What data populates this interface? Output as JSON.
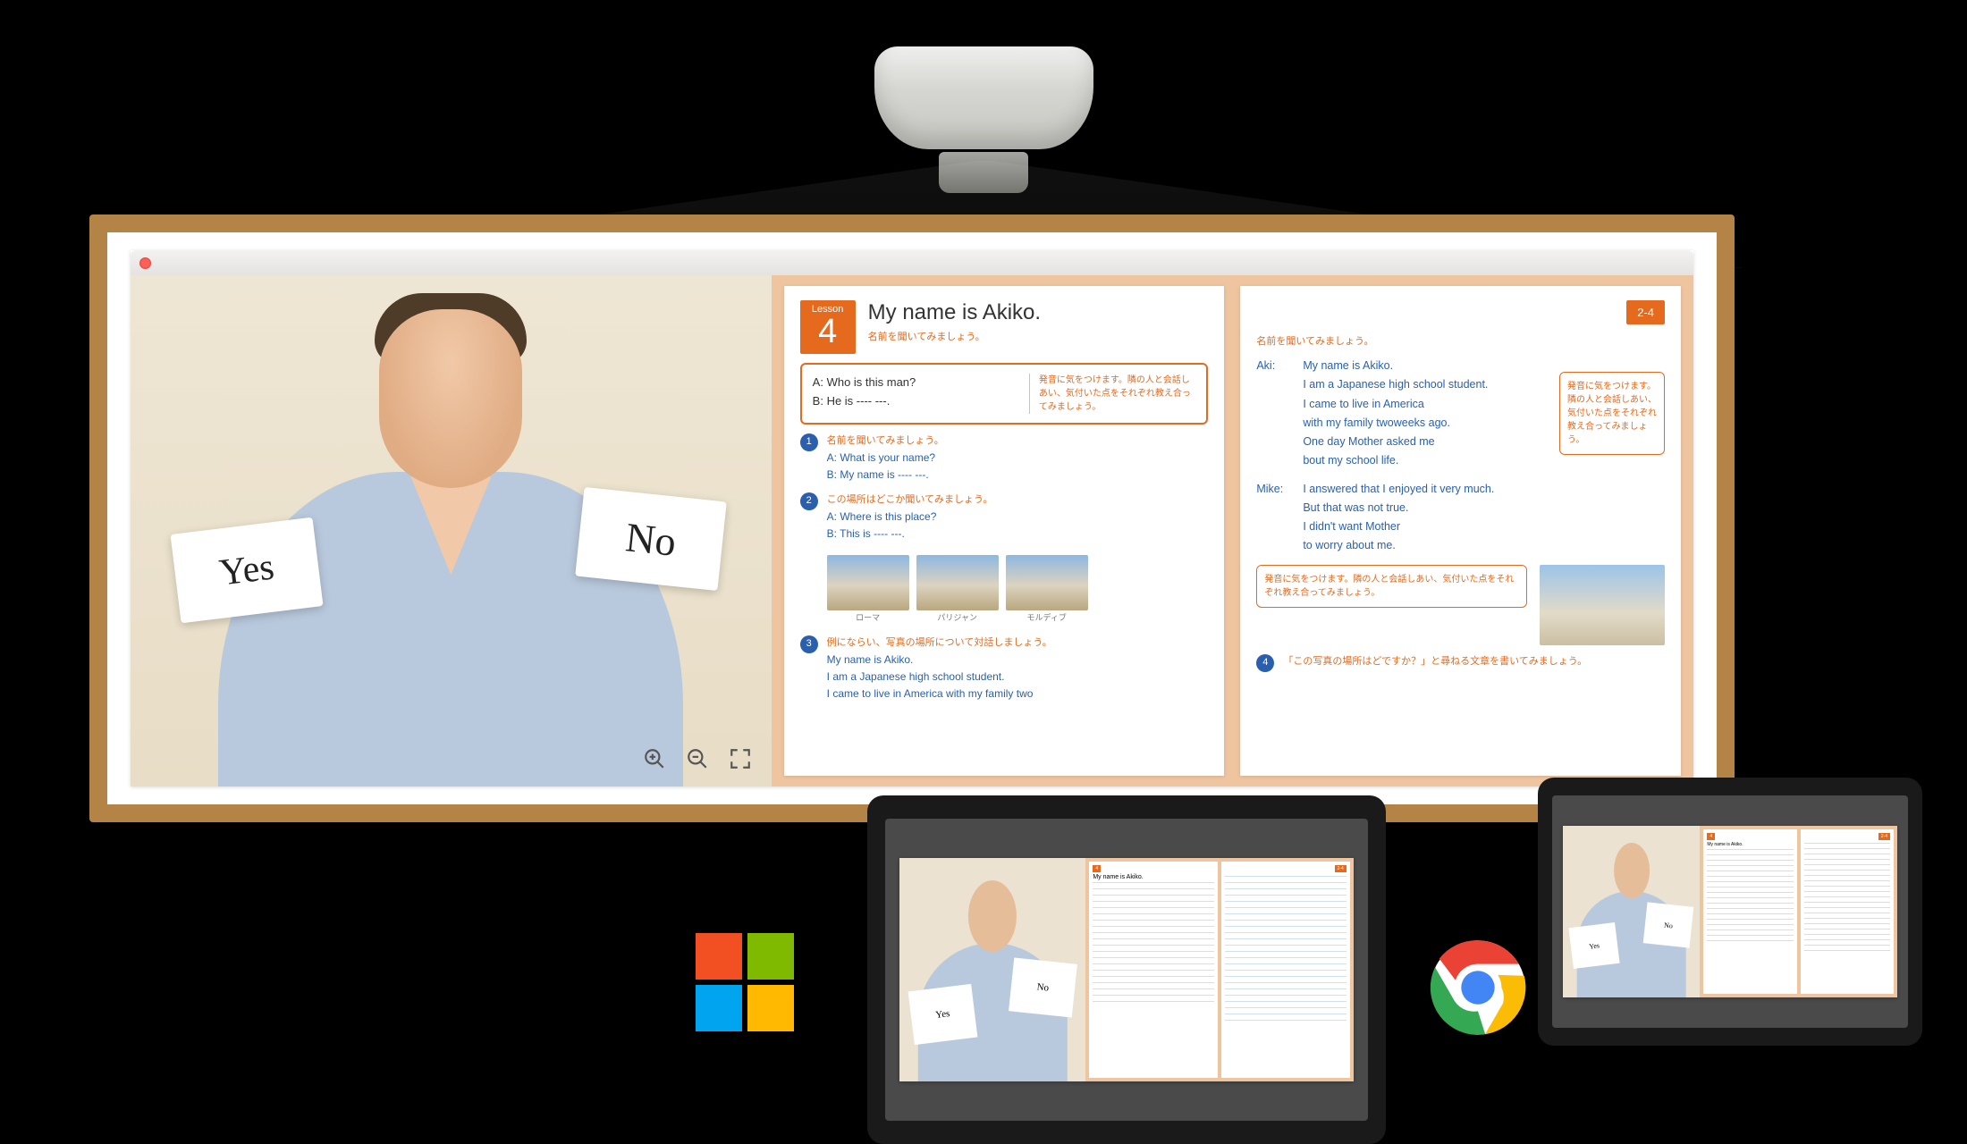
{
  "cards": {
    "yes": "Yes",
    "no": "No"
  },
  "lesson": {
    "label": "Lesson",
    "number": "4",
    "title": "My name is Akiko.",
    "subtitle": "名前を聞いてみましょう。",
    "page_badge": "2-4"
  },
  "qa_box": {
    "a": "A: Who is this man?",
    "b": "B: He is ---- ---.",
    "note": "発音に気をつけます。隣の人と会話しあい、気付いた点をそれぞれ教え合ってみましょう。"
  },
  "blocks": [
    {
      "num": "1",
      "jp": "名前を聞いてみましょう。",
      "lines": [
        "A: What is your name?",
        "B: My name is ---- ---."
      ]
    },
    {
      "num": "2",
      "jp": "この場所はどこか聞いてみましょう。",
      "lines": [
        "A: Where is this place?",
        "B: This is ---- ---."
      ]
    }
  ],
  "thumbs": [
    "ローマ",
    "パリジャン",
    "モルディブ"
  ],
  "block3": {
    "num": "3",
    "jp": "例にならい、写真の場所について対話しましょう。",
    "lines": [
      "My name is Akiko.",
      "I am a Japanese high school student.",
      "I came to live in America with my family two"
    ]
  },
  "right_page": {
    "heading": "名前を聞いてみましょう。",
    "dialogue": [
      {
        "speaker": "Aki:",
        "lines": [
          "My name is Akiko.",
          "I am a Japanese high school student.",
          "I came to live in America",
          "with my family twoweeks ago.",
          "One day Mother asked me",
          "bout my school life."
        ]
      },
      {
        "speaker": "Mike:",
        "lines": [
          "I answered that I enjoyed it very much.",
          "But that was not true.",
          "I didn't want Mother",
          "to worry about me."
        ]
      }
    ],
    "tip1": "発音に気をつけます。隣の人と会話しあい、気付いた点をそれぞれ教え合ってみましょう。",
    "tip2": "発音に気をつけます。隣の人と会話しあい、気付いた点をそれぞれ教え合ってみましょう。",
    "block4": {
      "num": "4",
      "jp": "「この写真の場所はどですか？」と尋ねる文章を書いてみましょう。"
    }
  },
  "zoom_icons": {
    "in": "zoom-in",
    "out": "zoom-out",
    "fullscreen": "fullscreen"
  }
}
